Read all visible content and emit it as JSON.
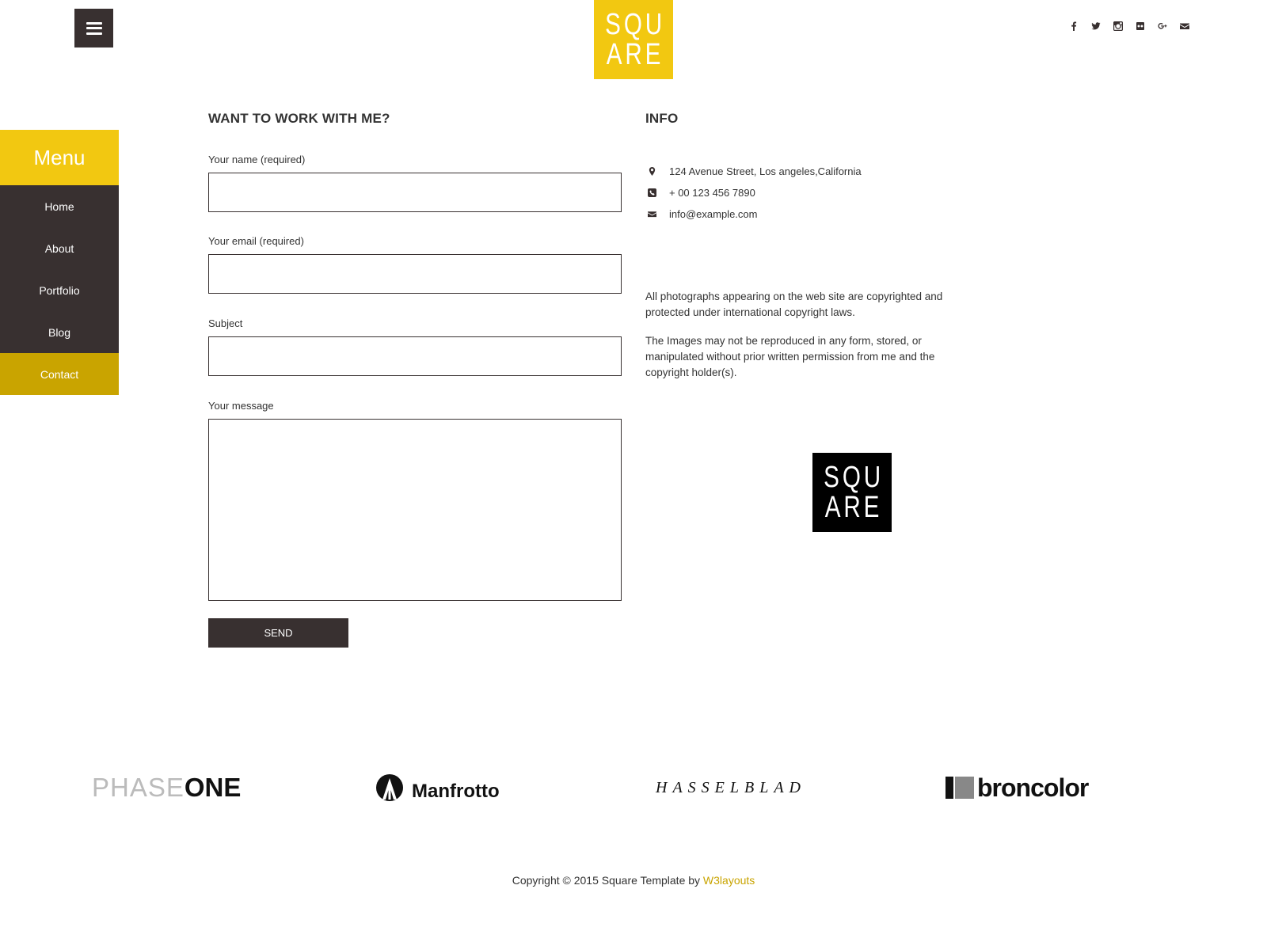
{
  "header": {
    "logo_line1": "SQU",
    "logo_line2": "ARE",
    "social_icons": [
      "facebook-icon",
      "twitter-icon",
      "instagram-icon",
      "flickr-icon",
      "google-plus-icon",
      "mail-icon"
    ]
  },
  "side_menu": {
    "title": "Menu",
    "items": [
      {
        "label": "Home",
        "active": false
      },
      {
        "label": "About",
        "active": false
      },
      {
        "label": "Portfolio",
        "active": false
      },
      {
        "label": "Blog",
        "active": false
      },
      {
        "label": "Contact",
        "active": true
      }
    ]
  },
  "form": {
    "title": "WANT TO WORK WITH ME?",
    "name_label": "Your name (required)",
    "name_value": "",
    "email_label": "Your email (required)",
    "email_value": "",
    "subject_label": "Subject",
    "subject_value": "",
    "message_label": "Your message",
    "message_value": "",
    "send_label": "SEND"
  },
  "info": {
    "title": "INFO",
    "address": "124 Avenue Street, Los angeles,California",
    "phone": "+ 00 123 456 7890",
    "email": "info@example.com",
    "paragraph_1": "All photographs appearing on the web site are copyrighted and protected under international copyright laws.",
    "paragraph_2": "The Images may not be reproduced in any form, stored, or manipulated without prior written permission from me and the copyright holder(s).",
    "logo_line1": "SQU",
    "logo_line2": "ARE"
  },
  "partners": {
    "phaseone_light": "PHASE",
    "phaseone_bold": "ONE",
    "manfrotto": "Manfrotto",
    "hasselblad": "HASSELBLAD",
    "broncolor": "broncolor"
  },
  "footer": {
    "copyright": "Copyright © 2015 Square Template by ",
    "link": "W3layouts"
  },
  "colors": {
    "accent_yellow": "#f2c811",
    "active_yellow": "#c9a400",
    "dark": "#383030"
  }
}
